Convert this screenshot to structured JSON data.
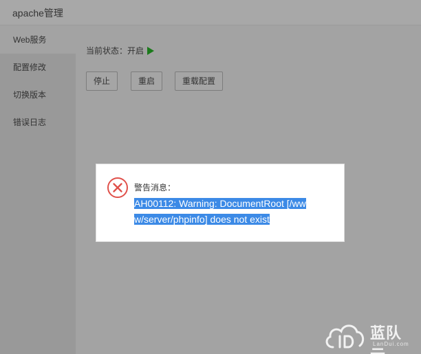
{
  "window": {
    "title": "apache管理"
  },
  "sidebar": {
    "items": [
      {
        "label": "Web服务",
        "active": true
      },
      {
        "label": "配置修改",
        "active": false
      },
      {
        "label": "切换版本",
        "active": false
      },
      {
        "label": "错误日志",
        "active": false
      }
    ]
  },
  "main": {
    "status_label": "当前状态：",
    "status_value": "开启",
    "status_icon": "play-icon",
    "buttons": {
      "stop": "停止",
      "restart": "重启",
      "reload": "重载配置"
    }
  },
  "dialog": {
    "icon": "error-circle-icon",
    "heading": "警告消息：",
    "message_line1": "AH00112: Warning: DocumentRoot [/ww",
    "message_line2": "w/server/phpinfo] does not exist"
  },
  "watermark": {
    "text": "蓝队云",
    "subtext": "LanDui.com"
  },
  "colors": {
    "status_green": "#1b7a1b",
    "error_red": "#e0504a",
    "selection_blue": "#3c8ae6"
  }
}
